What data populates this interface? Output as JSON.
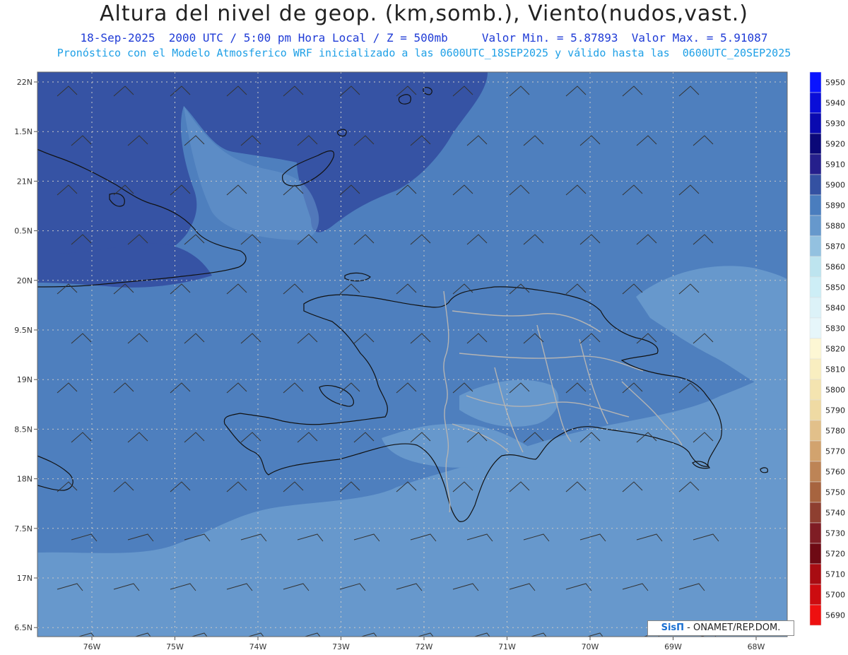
{
  "header": {
    "title": "Altura del nivel de geop. (km,somb.), Viento(nudos,vast.)",
    "subtitle_line1": "18-Sep-2025  2000 UTC / 5:00 pm Hora Local / Z = 500mb     Valor Min. = 5.87893  Valor Max. = 5.91087",
    "subtitle_line2": "Pronóstico con el Modelo Atmosferico WRF inicializado a las 0600UTC_18SEP2025 y válido hasta las  0600UTC_20SEP2025"
  },
  "map": {
    "lat_labels": [
      "22N",
      "1.5N",
      "21N",
      "0.5N",
      "20N",
      "9.5N",
      "19N",
      "8.5N",
      "18N",
      "7.5N",
      "17N",
      "6.5N"
    ],
    "lat_values": [
      22,
      21.5,
      21,
      20.5,
      20,
      19.5,
      19,
      18.5,
      18,
      17.5,
      17,
      16.5
    ],
    "lon_labels": [
      "76W",
      "75W",
      "74W",
      "73W",
      "72W",
      "71W",
      "70W",
      "69W",
      "68W"
    ],
    "lon_values": [
      -76,
      -75,
      -74,
      -73,
      -72,
      -71,
      -70,
      -69,
      -68
    ],
    "colors": {
      "deep": "#3653a4",
      "mid": "#4e7fbe",
      "light": "#6798cc",
      "lighter": "#7caad4",
      "coast": "#111111",
      "border": "#b4b4b4"
    }
  },
  "colorbar": {
    "levels": [
      "5950",
      "5940",
      "5930",
      "5920",
      "5910",
      "5900",
      "5890",
      "5880",
      "5870",
      "5860",
      "5850",
      "5840",
      "5830",
      "5820",
      "5810",
      "5800",
      "5790",
      "5780",
      "5770",
      "5760",
      "5750",
      "5740",
      "5730",
      "5720",
      "5710",
      "5700",
      "5690"
    ],
    "colors": [
      "#0a14ff",
      "#0a0ed8",
      "#0a0ab0",
      "#0b0878",
      "#251f8c",
      "#3451a2",
      "#4a7dbe",
      "#6698cc",
      "#93c1e0",
      "#bde4ef",
      "#cdeef6",
      "#dcf2f8",
      "#e6f6fa",
      "#fdf7d4",
      "#f9eec0",
      "#f4e4b0",
      "#efdaa3",
      "#e2c08a",
      "#d2a36e",
      "#bd8456",
      "#a7643f",
      "#8e3f30",
      "#7f1d24",
      "#6e0a14",
      "#a80c12",
      "#cc0c10",
      "#ee1010"
    ]
  },
  "credit": {
    "brand": "SisΠ",
    "text": " - ONAMET/REP.DOM."
  }
}
